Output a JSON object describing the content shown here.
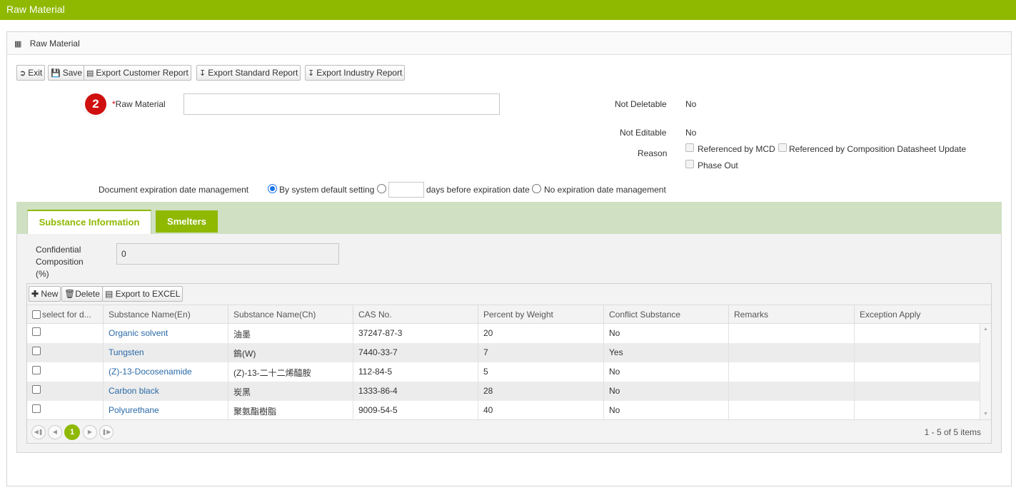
{
  "window_title": "Raw Material",
  "panel_title": "Raw Material",
  "toolbar": {
    "exit": "Exit",
    "save": "Save",
    "export_customer": "Export Customer Report",
    "export_standard": "Export Standard Report",
    "export_industry": "Export Industry Report"
  },
  "step_badge": "2",
  "form": {
    "raw_material_required": "*",
    "raw_material_label": "Raw Material",
    "raw_material_value": "",
    "not_deletable_label": "Not Deletable",
    "not_deletable_value": "No",
    "not_editable_label": "Not Editable",
    "not_editable_value": "No",
    "reason_label": "Reason",
    "reason_options": [
      "Referenced by MCD",
      "Referenced by Composition Datasheet Update",
      "Phase Out"
    ],
    "expiration_label": "Document expiration date management",
    "expiration_option1": "By system default setting",
    "expiration_days_value": "",
    "expiration_option2": "days before expiration date",
    "expiration_option3": "No expiration date management",
    "expiration_selected": "By system default setting"
  },
  "tabs": [
    {
      "label": "Substance Information",
      "active": true
    },
    {
      "label": "Smelters",
      "active": false
    }
  ],
  "confidential": {
    "label_line1": "Confidential",
    "label_line2": "Composition",
    "label_line3": "(%)",
    "value": "0"
  },
  "grid_toolbar": {
    "new": "New",
    "delete": "Delete",
    "export_excel": "Export to EXCEL"
  },
  "grid": {
    "columns": [
      "select for d...",
      "Substance Name(En)",
      "Substance Name(Ch)",
      "CAS No.",
      "Percent by Weight",
      "Conflict Substance",
      "Remarks",
      "Exception Apply"
    ],
    "rows": [
      {
        "name_en": "Organic solvent",
        "name_ch": "油墨",
        "cas": "37247-87-3",
        "percent": "20",
        "conflict": "No",
        "remarks": "",
        "exception": ""
      },
      {
        "name_en": "Tungsten",
        "name_ch": "鎢(W)",
        "cas": "7440-33-7",
        "percent": "7",
        "conflict": "Yes",
        "remarks": "",
        "exception": ""
      },
      {
        "name_en": "(Z)-13-Docosenamide",
        "name_ch": "(Z)-13-二十二烯醯胺",
        "cas": "112-84-5",
        "percent": "5",
        "conflict": "No",
        "remarks": "",
        "exception": ""
      },
      {
        "name_en": "Carbon black",
        "name_ch": "炭黑",
        "cas": "1333-86-4",
        "percent": "28",
        "conflict": "No",
        "remarks": "",
        "exception": ""
      },
      {
        "name_en": "Polyurethane",
        "name_ch": "聚氨酯樹脂",
        "cas": "9009-54-5",
        "percent": "40",
        "conflict": "No",
        "remarks": "",
        "exception": ""
      }
    ]
  },
  "pager": {
    "current_page": "1",
    "summary": "1 - 5 of 5 items"
  },
  "colors": {
    "brand_green": "#8fb800",
    "tab_strip": "#cfe0c3",
    "link_blue": "#2a6aa8",
    "badge_red": "#d01010"
  }
}
